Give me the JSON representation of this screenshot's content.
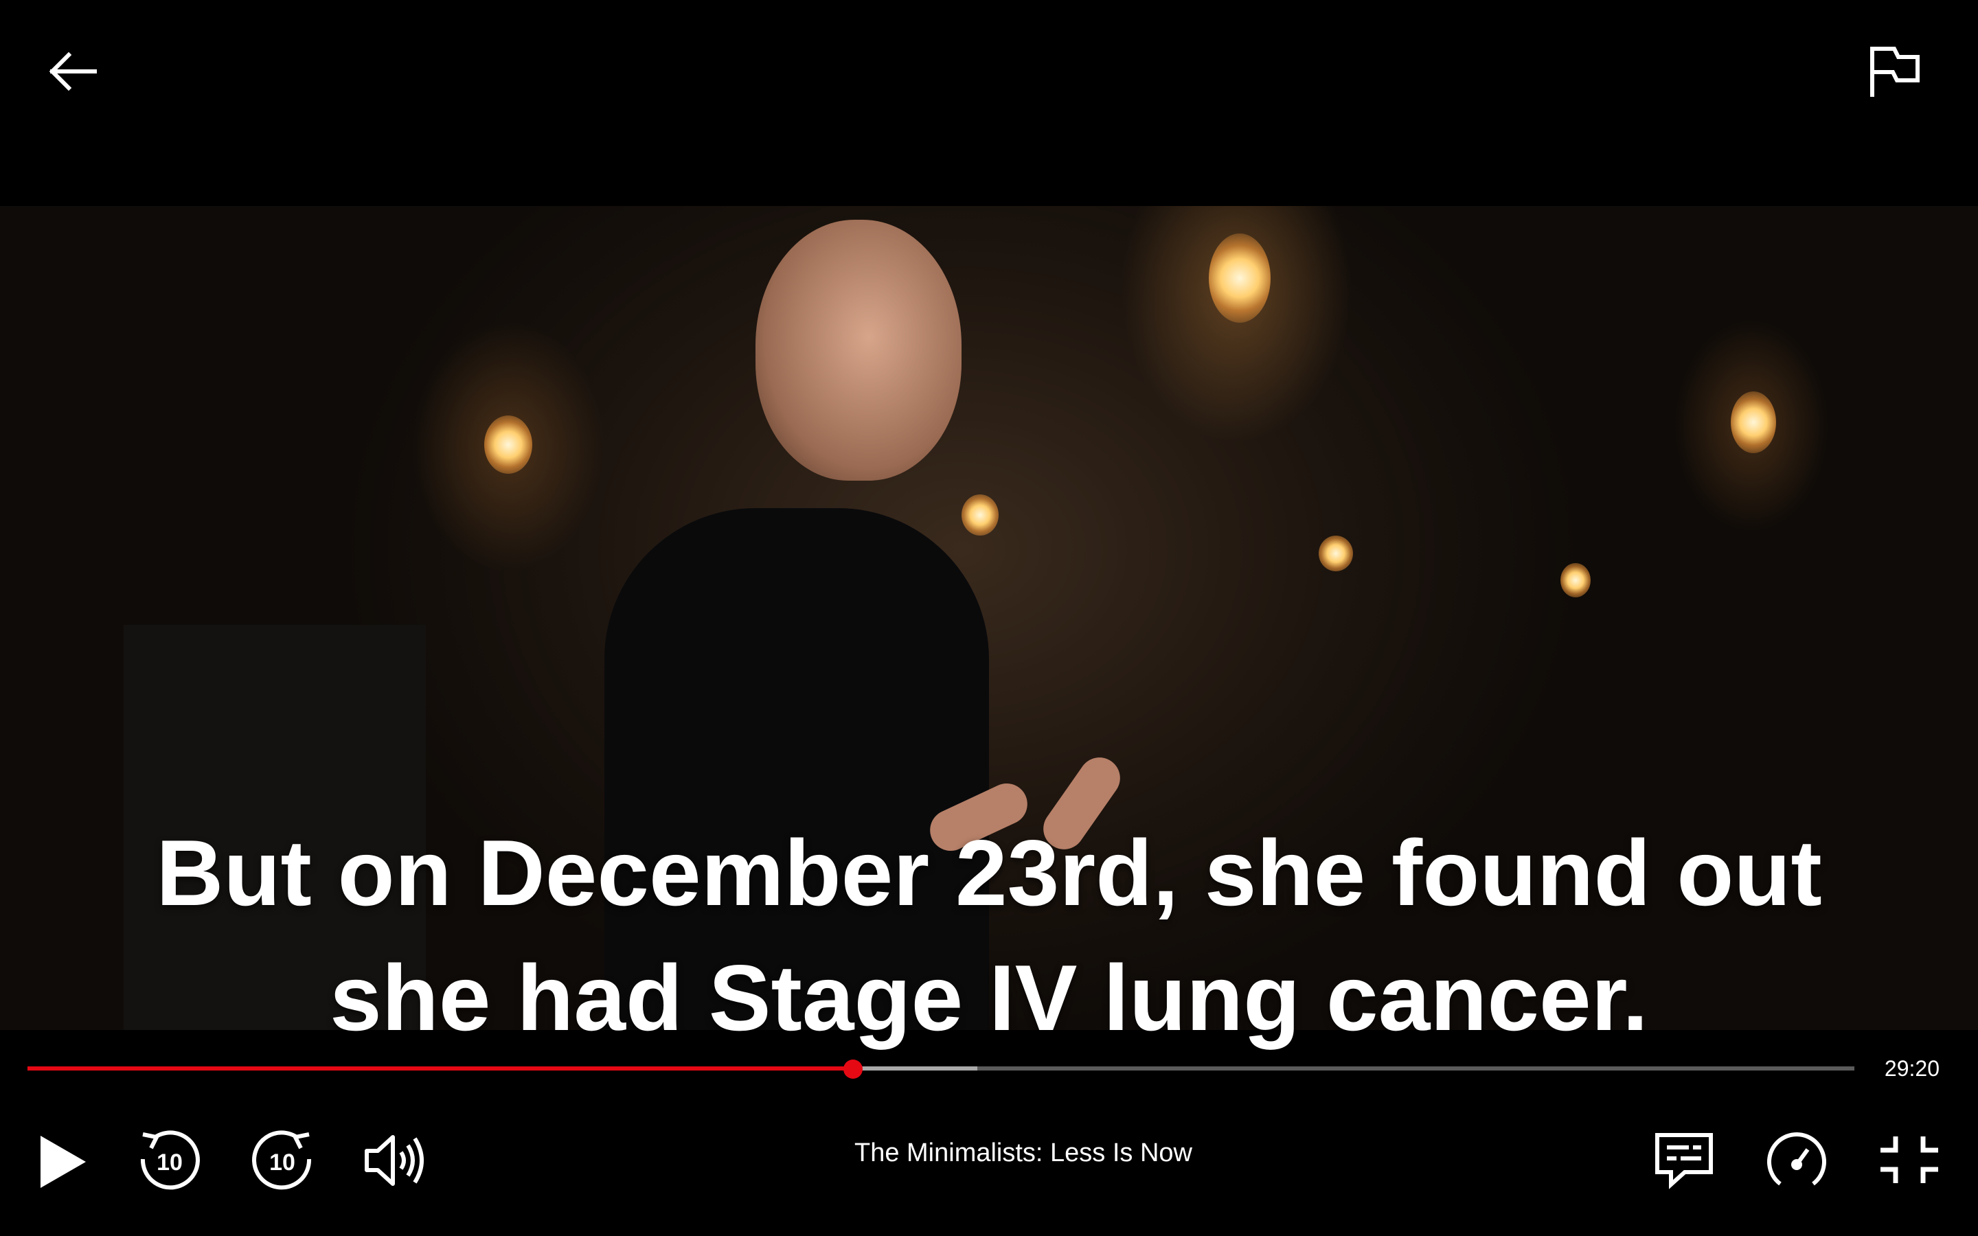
{
  "player": {
    "subtitle_lines": [
      "But on December 23rd, she found out",
      "she had Stage IV lung cancer."
    ],
    "time_remaining": "29:20",
    "title": "The Minimalists: Less Is Now",
    "progress": {
      "played_fraction": 0.452,
      "buffered_fraction": 0.52
    },
    "colors": {
      "accent": "#e50914",
      "background": "#000000",
      "text": "#ffffff"
    },
    "icons": {
      "back": "back-arrow-icon",
      "report": "flag-icon",
      "play": "play-icon",
      "rewind": "rewind-10-icon",
      "forward": "forward-10-icon",
      "volume": "volume-icon",
      "subtitles": "subtitles-icon",
      "speed": "playback-speed-icon",
      "fullscreen": "exit-fullscreen-icon"
    },
    "skip_seconds": "10"
  }
}
